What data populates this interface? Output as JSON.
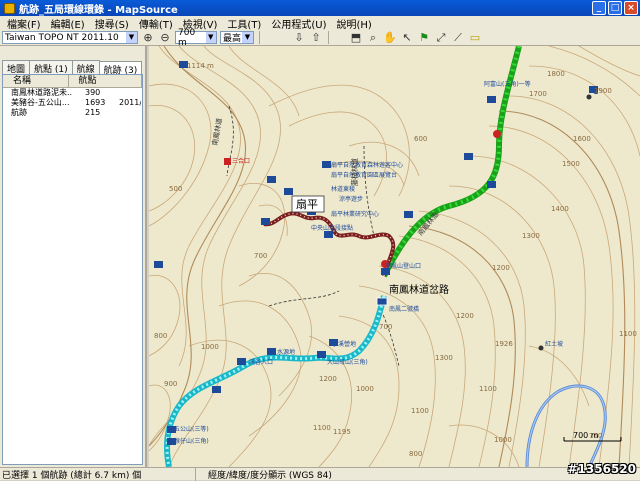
{
  "window": {
    "title": "航跡_五局環線環錄 - MapSource"
  },
  "menu": [
    "檔案(F)",
    "編輯(E)",
    "搜尋(S)",
    "傳輸(T)",
    "檢視(V)",
    "工具(T)",
    "公用程式(U)",
    "說明(H)"
  ],
  "toolbar": {
    "map_product": "Taiwan TOPO NT 2011.10",
    "zoom_value": "700 m",
    "detail_value": "最高"
  },
  "left_pane": {
    "tabs": [
      "地圖",
      "航點 (1)",
      "航線",
      "航跡 (3)"
    ],
    "columns": [
      "名稱",
      "航點"
    ],
    "rows": [
      {
        "name": "南鳳林道路泥未...",
        "points": "390",
        "extra": ""
      },
      {
        "name": "美豬谷-五公山...",
        "points": "1693",
        "extra": "2011/"
      },
      {
        "name": "航跡",
        "points": "215",
        "extra": ""
      }
    ]
  },
  "map": {
    "labels": {
      "peak": "扇平",
      "road": "南鳳林道岔路",
      "wp_top": "阿富山(三角)一等",
      "wp_a": "扇平自然教育森林遊客中心",
      "wp_b": "扇平自然教育園區展覽台",
      "wp_c": "扇平林業研究中心",
      "wp_d": "中央山北段接點",
      "wp_e": "林道東稜",
      "wp_f": "涼亭遊步",
      "wp_g": "小溪營地",
      "wp_h": "水源地",
      "wp_i": "五公山(三等)",
      "wp_j": "猴仔山(三角)",
      "wp_k": "南鳳山登山口",
      "wp_l": "南鳳二號橋",
      "wp_m": "大山母山(三角)",
      "wp_n": "溪谷入口",
      "wp_o": "三合口",
      "wp_p": "紅土坡",
      "road_v1": "南鳳林道",
      "road_v2": "藤枝林道",
      "road_v3": "南鳳林道",
      "scale": "700 m"
    },
    "contours": [
      "1114 m",
      "500",
      "700",
      "700",
      "800",
      "900",
      "1000",
      "1200",
      "1000",
      "1100",
      "1195",
      "1100",
      "1300",
      "1200",
      "1200",
      "1300",
      "1400",
      "1500",
      "1600",
      "1700",
      "1800",
      "1900",
      "1926",
      "1100",
      "1000",
      "800",
      "700",
      "600",
      "1100"
    ]
  },
  "status": {
    "selection": "已選擇 1 個航跡 (總計 6.7 km) 個",
    "coords": "經度/緯度/度分顯示 (WGS 84)"
  },
  "watermark": "#1356520",
  "colors": {
    "track_green": "#22cc22",
    "track_cyan": "#22cccc",
    "track_brown": "#8b2a2a"
  }
}
